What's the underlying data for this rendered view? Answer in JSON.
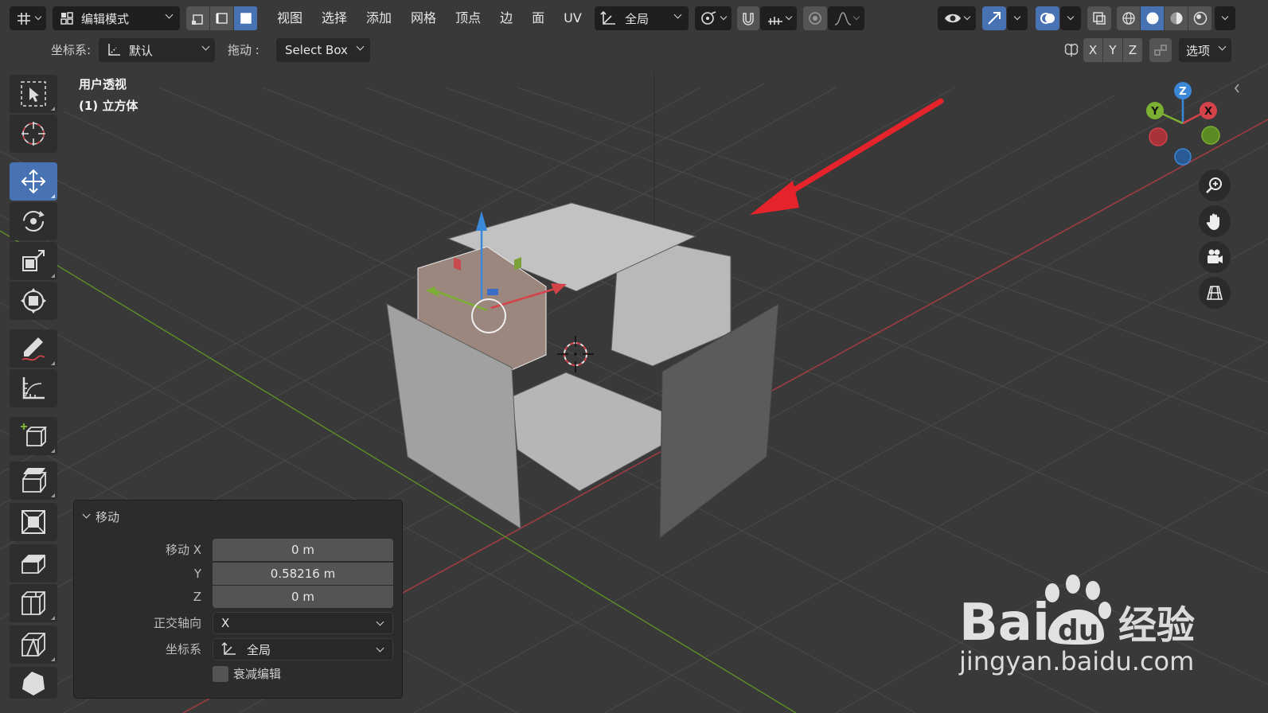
{
  "header": {
    "mode_label": "编辑模式",
    "menus": [
      "视图",
      "选择",
      "添加",
      "网格",
      "顶点",
      "边",
      "面",
      "UV"
    ],
    "orientation_label": "全局"
  },
  "toolsettings": {
    "coord_label": "坐标系:",
    "coord_value": "默认",
    "drag_label": "拖动 :",
    "drag_value": "Select Box",
    "axes": [
      "X",
      "Y",
      "Z"
    ],
    "options_label": "选项"
  },
  "viewport": {
    "view_name": "用户透视",
    "object_name": "(1) 立方体"
  },
  "gizmo": {
    "z_label": "Z",
    "y_label": "Y",
    "x_label": "X"
  },
  "operator_panel": {
    "title": "移动",
    "move_x_label": "移动 X",
    "move_x_value": "0 m",
    "move_y_label": "Y",
    "move_y_value": "0.58216 m",
    "move_z_label": "Z",
    "move_z_value": "0 m",
    "orient_axis_label": "正交轴向",
    "orient_axis_value": "X",
    "coord_label": "坐标系",
    "coord_value": "全局",
    "proportional_label": "衰减编辑"
  },
  "watermark": {
    "brand": "Bai",
    "brand_tail": "经验",
    "url": "jingyan.baidu.com"
  },
  "colors": {
    "accent": "#4772b3",
    "x_axis": "#d5434a",
    "y_axis": "#7cb032",
    "z_axis": "#3b88d8",
    "arrow": "#e5232b"
  }
}
